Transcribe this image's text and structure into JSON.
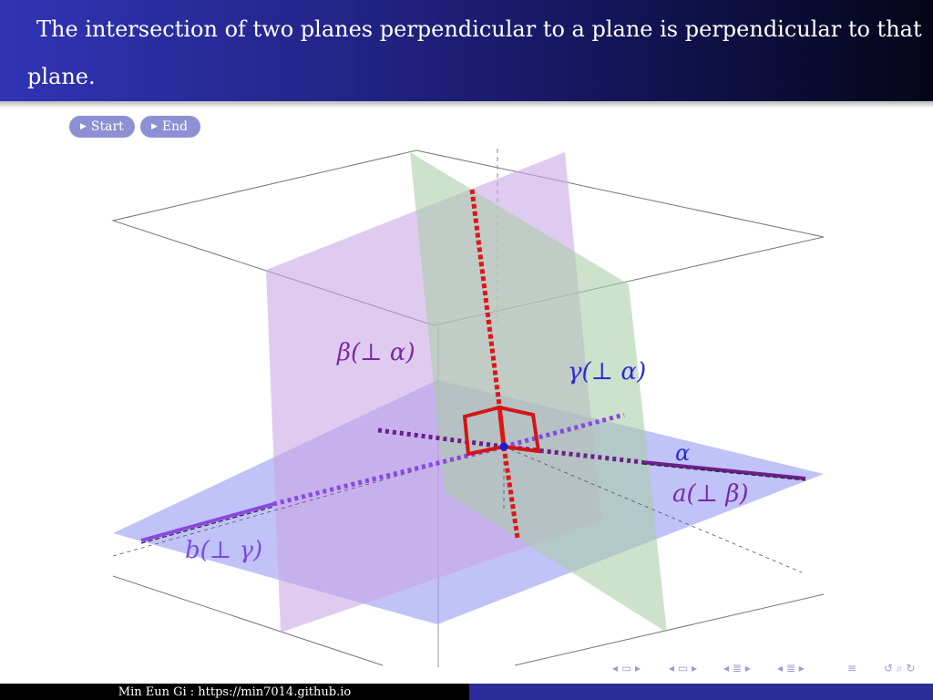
{
  "slide": {
    "title_line1": "The intersection of two planes perpendicular to a plane is perpendicular to that",
    "title_line2": "plane."
  },
  "buttons": {
    "start": "Start",
    "end": "End",
    "play_icon": "play-triangle-icon"
  },
  "diagram": {
    "labels": {
      "beta": "β(⊥ α)",
      "gamma": "γ(⊥ α)",
      "alpha": "α",
      "line_a": "a(⊥ β)",
      "line_b": "b(⊥ γ)"
    },
    "colors": {
      "plane_alpha": "#9a9cf4",
      "plane_beta": "#c9a6e6",
      "plane_gamma": "#a9cda6",
      "intersection_line": "#e01515",
      "right_angle": "#d41515",
      "line_a": "#6a1f8c",
      "line_b": "#8a48e0",
      "label_blue": "#2a2ad8",
      "label_purple": "#7a2aa0"
    }
  },
  "footer": {
    "author": "Min Eun Gi : https://min7014.github.io"
  },
  "beamer_nav_icons": [
    "prev-frame-icon",
    "prev-subsection-icon",
    "prev-section-icon",
    "prev-slide-icon",
    "align-icon",
    "search-icon"
  ]
}
